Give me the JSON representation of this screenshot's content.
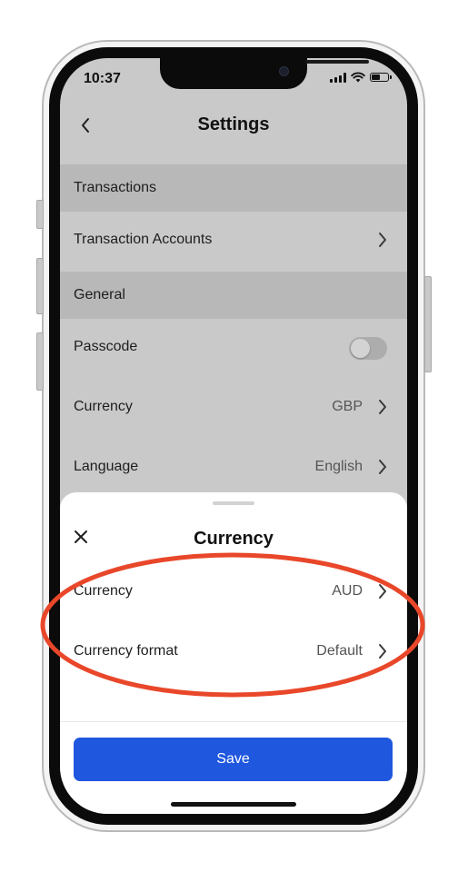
{
  "status_bar": {
    "time": "10:37"
  },
  "nav": {
    "title": "Settings",
    "back_icon": "chevron-left-icon"
  },
  "sections": {
    "transactions": {
      "header": "Transactions",
      "items": [
        {
          "label": "Transaction Accounts"
        }
      ]
    },
    "general": {
      "header": "General",
      "items": [
        {
          "label": "Passcode",
          "toggle_on": false
        },
        {
          "label": "Currency",
          "value": "GBP"
        },
        {
          "label": "Language",
          "value": "English"
        }
      ]
    }
  },
  "sheet": {
    "title": "Currency",
    "close_icon": "close-icon",
    "rows": [
      {
        "label": "Currency",
        "value": "AUD"
      },
      {
        "label": "Currency format",
        "value": "Default"
      }
    ],
    "save_label": "Save"
  },
  "colors": {
    "primary_button": "#1f57de",
    "dim_background": "#c9c9c9",
    "annotation": "#e9472a"
  }
}
